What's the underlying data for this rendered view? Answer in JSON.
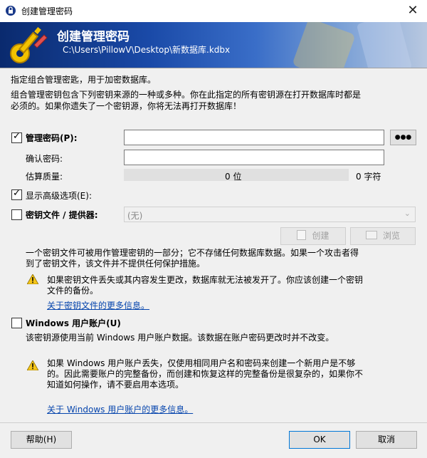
{
  "window": {
    "title": "创建管理密码",
    "close_glyph": "✕"
  },
  "banner": {
    "title": "创建管理密码",
    "path": "C:\\Users\\PillowV\\Desktop\\新数据库.kdbx"
  },
  "intro": {
    "line1": "指定组合管理密匙，用于加密数据库。",
    "line2": "组合管理密钥包含下列密钥来源的一种或多种。你在此指定的所有密钥源在打开数据库时都是",
    "line3": "必须的。如果你遗失了一个密钥源，你将无法再打开数据库！"
  },
  "master_password": {
    "checked": true,
    "label": "管理密码(P):",
    "value": "",
    "toggle_label": "●●●",
    "confirm_label": "确认密码:",
    "confirm_value": "",
    "quality_label": "估算质量:",
    "quality_bits": "0 位",
    "quality_chars": "0 字符"
  },
  "advanced": {
    "checked": true,
    "label": "显示高级选项(E):"
  },
  "key_file": {
    "checked": false,
    "label": "密钥文件 / 提供器:",
    "selected": "(无)",
    "create_label": "创建",
    "browse_label": "浏览",
    "desc1": "一个密钥文件可被用作管理密钥的一部分；它不存储任何数据库数据。如果一个攻击者得",
    "desc2": "到了密钥文件，该文件并不提供任何保护措施。",
    "warn1": "如果密钥文件丢失或其内容发生更改，数据库就无法被发开了。你应该创建一个密钥",
    "warn2": "文件的备份。",
    "link": "关于密钥文件的更多信息。"
  },
  "windows_account": {
    "checked": false,
    "label": "Windows 用户账户(U)",
    "desc": "该密钥源使用当前 Windows 用户账户数据。该数据在账户密码更改时并不改变。",
    "warn1": "如果 Windows 用户账户丢失，仅使用相同用户名和密码来创建一个新用户是不够",
    "warn2": "的。因此需要账户的完整备份，而创建和恢复这样的完整备份是很复杂的，如果你不",
    "warn3": "知道如何操作，请不要启用本选项。",
    "link": "关于 Windows 用户账户的更多信息。"
  },
  "footer": {
    "help_label": "帮助(H)",
    "ok_label": "OK",
    "cancel_label": "取消"
  },
  "icons": {
    "app": "lock-icon",
    "banner": "key-icon",
    "warning": "warning-icon",
    "create": "create-file-icon",
    "browse": "folder-icon",
    "dropdown": "chevron-down-icon"
  },
  "colors": {
    "accent": "#0078d7",
    "link": "#0645ad",
    "banner_dark": "#0a2a6e"
  }
}
